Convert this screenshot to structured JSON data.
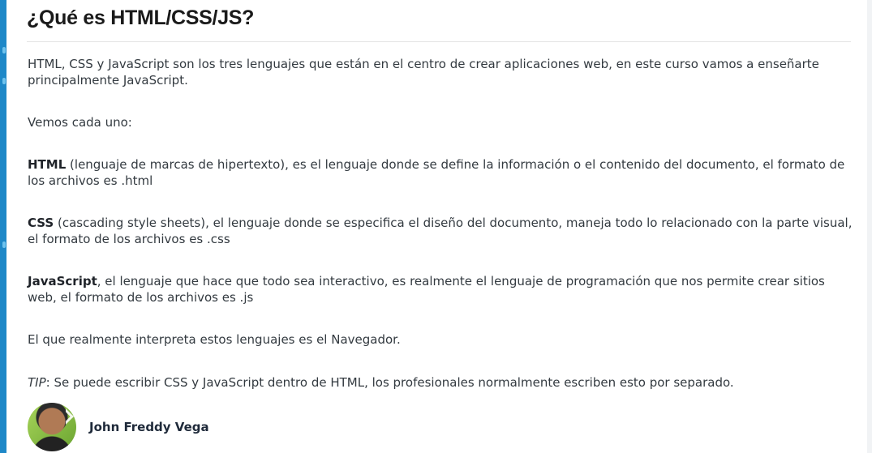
{
  "article": {
    "title": "¿Qué es HTML/CSS/JS?",
    "intro": "HTML, CSS y JavaScript son los tres lenguajes que están en el centro de crear aplicaciones web, en este curso vamos a enseñarte principalmente JavaScript.",
    "lead": "Vemos cada uno:",
    "items": [
      {
        "term": "HTML",
        "text": " (lenguaje de marcas de hipertexto), es el lenguaje donde se define la información o el contenido del documento, el formato de los archivos es .html"
      },
      {
        "term": "CSS",
        "text": " (cascading style sheets), el lenguaje donde se especifica el diseño del documento, maneja todo lo relacionado con la parte visual, el formato de los archivos es .css"
      },
      {
        "term": "JavaScript",
        "text": ", el lenguaje que hace que todo sea interactivo, es realmente el lenguaje de programación que nos permite crear sitios web, el formato de los archivos es .js"
      }
    ],
    "browser_note": "El que realmente interpreta estos lenguajes es el Navegador.",
    "tip_label": "TIP",
    "tip_text": ": Se puede escribir CSS y JavaScript dentro de HTML, los profesionales normalmente escriben esto por separado."
  },
  "author": {
    "name": "John Freddy Vega"
  },
  "colors": {
    "accent": "#1e88c8",
    "text": "#333a40",
    "heading": "#1a1a1a"
  }
}
